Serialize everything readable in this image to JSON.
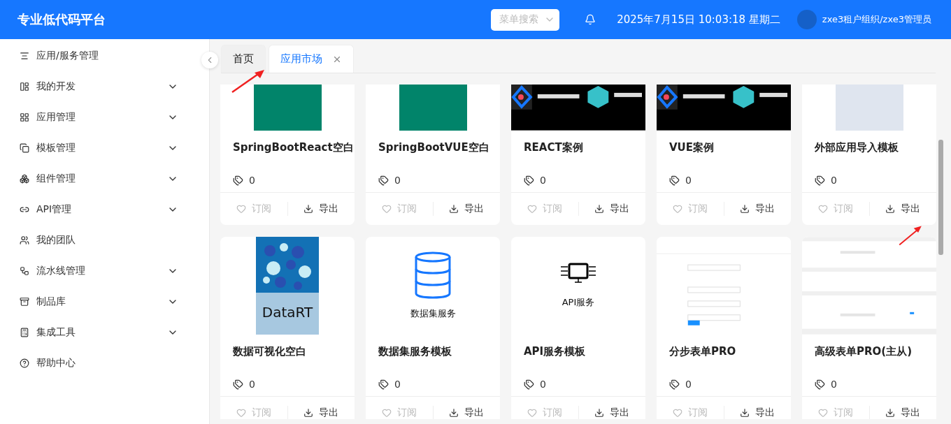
{
  "header": {
    "title": "专业低代码平台",
    "menu_search": {
      "placeholder": "菜单搜索"
    },
    "datetime": "2025年7月15日 10:03:18 星期二",
    "user": "zxe3租户组织/zxe3管理员"
  },
  "sidebar": {
    "items": [
      {
        "label": "应用/服务管理",
        "expandable": false
      },
      {
        "label": "我的开发",
        "expandable": true
      },
      {
        "label": "应用管理",
        "expandable": true
      },
      {
        "label": "模板管理",
        "expandable": true
      },
      {
        "label": "组件管理",
        "expandable": true
      },
      {
        "label": "API管理",
        "expandable": true
      },
      {
        "label": "我的团队",
        "expandable": false
      },
      {
        "label": "流水线管理",
        "expandable": true
      },
      {
        "label": "制品库",
        "expandable": true
      },
      {
        "label": "集成工具",
        "expandable": true
      },
      {
        "label": "帮助中心",
        "expandable": false
      }
    ]
  },
  "tabs": [
    {
      "label": "首页",
      "selected": false,
      "closable": false
    },
    {
      "label": "应用市场",
      "selected": true,
      "closable": true
    }
  ],
  "cards": [
    {
      "title": "SpringBootReact空白",
      "tags": "0",
      "thumb": {
        "kind": "green"
      },
      "actions": [
        {
          "label": "订阅",
          "kind": "subscribe",
          "disabled": true
        },
        {
          "label": "导出",
          "kind": "export",
          "disabled": false
        }
      ]
    },
    {
      "title": "SpringBootVUE空白",
      "tags": "0",
      "thumb": {
        "kind": "green"
      },
      "actions": [
        {
          "label": "订阅",
          "kind": "subscribe",
          "disabled": true
        },
        {
          "label": "导出",
          "kind": "export",
          "disabled": false
        }
      ]
    },
    {
      "title": "REACT案例",
      "tags": "0",
      "thumb": {
        "kind": "dark"
      },
      "actions": [
        {
          "label": "订阅",
          "kind": "subscribe",
          "disabled": true
        },
        {
          "label": "导出",
          "kind": "export",
          "disabled": false
        }
      ]
    },
    {
      "title": "VUE案例",
      "tags": "0",
      "thumb": {
        "kind": "dark"
      },
      "actions": [
        {
          "label": "订阅",
          "kind": "subscribe",
          "disabled": true
        },
        {
          "label": "导出",
          "kind": "export",
          "disabled": false
        }
      ]
    },
    {
      "title": "外部应用导入模板",
      "tags": "0",
      "thumb": {
        "kind": "plain"
      },
      "actions": [
        {
          "label": "订阅",
          "kind": "subscribe",
          "disabled": true
        },
        {
          "label": "导出",
          "kind": "export",
          "disabled": false
        }
      ]
    },
    {
      "title": "数据可视化空白",
      "tags": "0",
      "thumb": {
        "kind": "bubbles",
        "caption": "DataRT"
      },
      "actions": [
        {
          "label": "订阅",
          "kind": "subscribe",
          "disabled": true
        },
        {
          "label": "导出",
          "kind": "export",
          "disabled": false
        }
      ]
    },
    {
      "title": "数据集服务模板",
      "tags": "0",
      "thumb": {
        "kind": "database",
        "caption": "数据集服务"
      },
      "actions": [
        {
          "label": "订阅",
          "kind": "subscribe",
          "disabled": true
        },
        {
          "label": "导出",
          "kind": "export",
          "disabled": false
        }
      ]
    },
    {
      "title": "API服务模板",
      "tags": "0",
      "thumb": {
        "kind": "monitor",
        "caption": "API服务"
      },
      "actions": [
        {
          "label": "订阅",
          "kind": "subscribe",
          "disabled": true
        },
        {
          "label": "导出",
          "kind": "export",
          "disabled": false
        }
      ]
    },
    {
      "title": "分步表单PRO",
      "tags": "0",
      "thumb": {
        "kind": "form"
      },
      "actions": [
        {
          "label": "订阅",
          "kind": "subscribe",
          "disabled": true
        },
        {
          "label": "导出",
          "kind": "export",
          "disabled": false
        }
      ]
    },
    {
      "title": "高级表单PRO(主从)",
      "tags": "0",
      "thumb": {
        "kind": "table"
      },
      "actions": [
        {
          "label": "订阅",
          "kind": "subscribe",
          "disabled": true
        },
        {
          "label": "导出",
          "kind": "export",
          "disabled": false
        }
      ]
    }
  ]
}
